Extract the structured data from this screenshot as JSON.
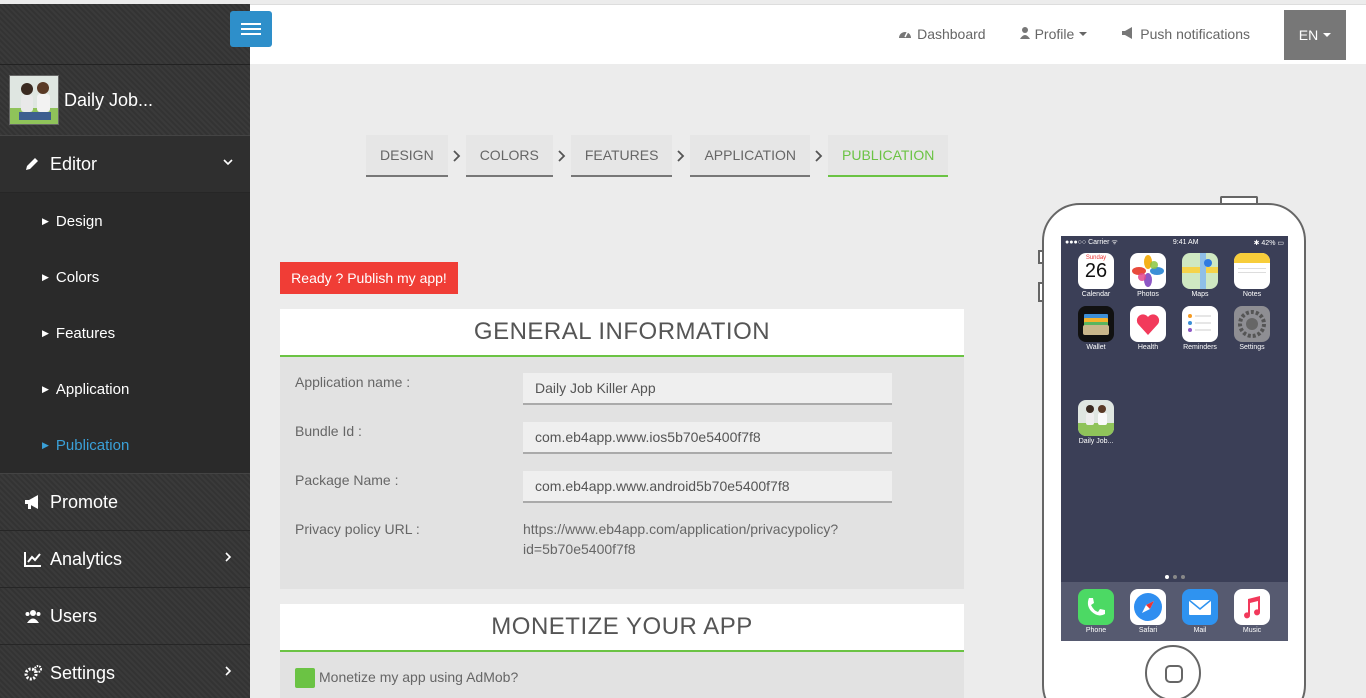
{
  "sidebar": {
    "app_name": "Daily Job...",
    "editor_label": "Editor",
    "submenu": [
      {
        "label": "Design"
      },
      {
        "label": "Colors"
      },
      {
        "label": "Features"
      },
      {
        "label": "Application"
      },
      {
        "label": "Publication"
      }
    ],
    "promote_label": "Promote",
    "analytics_label": "Analytics",
    "users_label": "Users",
    "settings_label": "Settings"
  },
  "topbar": {
    "dashboard_label": "Dashboard",
    "profile_label": "Profile",
    "push_label": "Push notifications",
    "lang_label": "EN"
  },
  "steps": [
    "DESIGN",
    "COLORS",
    "FEATURES",
    "APPLICATION",
    "PUBLICATION"
  ],
  "publish_button": "Ready ? Publish my app!",
  "general": {
    "title": "GENERAL INFORMATION",
    "app_name_label": "Application name :",
    "app_name_value": "Daily Job Killer App",
    "bundle_label": "Bundle Id :",
    "bundle_value": "com.eb4app.www.ios5b70e5400f7f8",
    "package_label": "Package Name :",
    "package_value": "com.eb4app.www.android5b70e5400f7f8",
    "privacy_label": "Privacy policy URL :",
    "privacy_value_1": "https://www.eb4app.com/application/privacypolicy?",
    "privacy_value_2": "id=5b70e5400f7f8"
  },
  "monetize": {
    "title": "MONETIZE YOUR APP",
    "admob_label": "Monetize my app using AdMob?"
  },
  "phone": {
    "carrier": "●●●○○ Carrier ᯤ",
    "time": "9:41 AM",
    "battery": "✱ 42% ▭",
    "calendar_day": "Sunday",
    "calendar_date": "26",
    "apps": [
      "Calendar",
      "Photos",
      "Maps",
      "Notes",
      "Wallet",
      "Health",
      "Reminders",
      "Settings"
    ],
    "custom_app": "Daily Job...",
    "dock": [
      "Phone",
      "Safari",
      "Mail",
      "Music"
    ]
  },
  "colors": {
    "accent_green": "#6bc344",
    "publish_red": "#f03d36",
    "hamburger_blue": "#2e8fca"
  }
}
